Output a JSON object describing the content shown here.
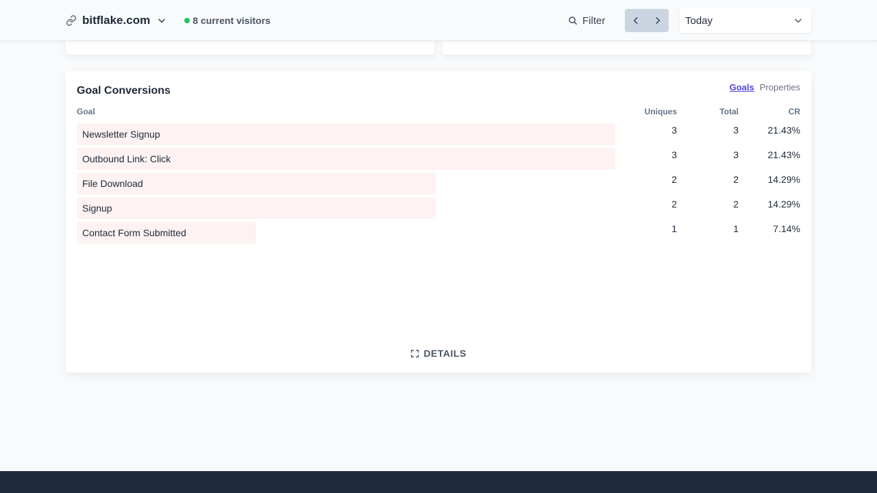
{
  "header": {
    "site_name": "bitflake.com",
    "visitors": "8 current visitors",
    "filter_label": "Filter",
    "period": "Today"
  },
  "goals_card": {
    "title": "Goal Conversions",
    "tabs": {
      "goals": "Goals",
      "properties": "Properties"
    },
    "columns": {
      "goal": "Goal",
      "uniques": "Uniques",
      "total": "Total",
      "cr": "CR"
    },
    "rows": [
      {
        "goal": "Newsletter Signup",
        "uniques": "3",
        "total": "3",
        "cr": "21.43%",
        "fraction": 1.0
      },
      {
        "goal": "Outbound Link: Click",
        "uniques": "3",
        "total": "3",
        "cr": "21.43%",
        "fraction": 1.0
      },
      {
        "goal": "File Download",
        "uniques": "2",
        "total": "2",
        "cr": "14.29%",
        "fraction": 0.667
      },
      {
        "goal": "Signup",
        "uniques": "2",
        "total": "2",
        "cr": "14.29%",
        "fraction": 0.667
      },
      {
        "goal": "Contact Form Submitted",
        "uniques": "1",
        "total": "1",
        "cr": "7.14%",
        "fraction": 0.333
      }
    ],
    "details_label": "DETAILS"
  },
  "colors": {
    "accent": "#4f46e5",
    "bar_fill": "#fef2f2",
    "live_dot": "#22c55e",
    "footer": "#1e293b"
  }
}
